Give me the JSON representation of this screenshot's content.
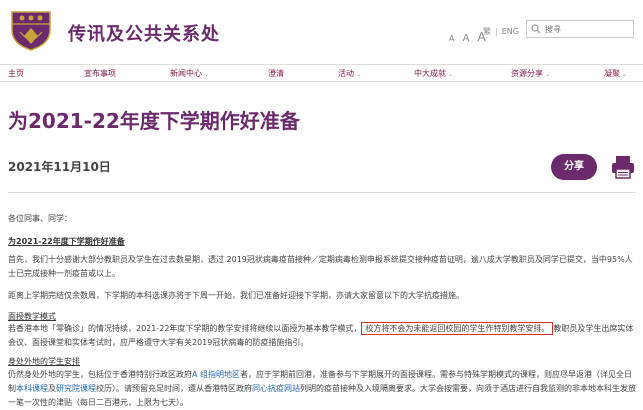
{
  "header": {
    "site_title": "传讯及公共关系处",
    "font_sizes": [
      "A",
      "A",
      "A"
    ],
    "lang_trad": "繁",
    "lang_en": "ENG",
    "search_placeholder": "搜寻"
  },
  "nav": {
    "items": [
      {
        "label": "主页",
        "has_menu": false
      },
      {
        "label": "宣布事项",
        "has_menu": false
      },
      {
        "label": "新闻中心",
        "has_menu": true
      },
      {
        "label": "澄清",
        "has_menu": false
      },
      {
        "label": "活动",
        "has_menu": true
      },
      {
        "label": "中大成就",
        "has_menu": true
      },
      {
        "label": "资源分享",
        "has_menu": true
      },
      {
        "label": "凝聚",
        "has_menu": true
      }
    ],
    "chevron": "⌄"
  },
  "article": {
    "title": "为2021-22年度下学期作好准备",
    "date": "2021年11月10日",
    "share_label": "分享",
    "greeting": "各位同事、同学：",
    "heading1": "为2021-22年度下学期作好准备",
    "para1": "首先，我们十分感谢大部分教职员及学生在过去数星期，透过 2019冠状病毒疫苗接种／定期病毒检测申报系统提交接种疫苗证明，逾八成大学教职员及同学已提交，当中95%人士已完成接种一剂疫苗或以上。",
    "para2": "距离上学期完结仅余数周，下学期的本科选课亦将于下周一开始，我们已准备好迎接下学期，亦请大家留意以下的大学抗疫措施。",
    "heading2": "面授教学模式",
    "para3_a": "若香港本地「零确诊」的情况持续，2021-22年度下学期的教学安排将继续以面授为基本教学模式，",
    "para3_highlight": "校方将不会为未能返回校园的学生作特别教学安排。",
    "para3_b": "教职员及学生出席实体会议、面授课堂和实体考试时，应严格遵守大学有关2019冠状病毒的防疫措施指引。",
    "heading3": "身处外地的学生安排",
    "para4_a": "仍然身处外地的学生，包括位于香港特别行政区政府",
    "para4_link1": "A 组指明地区",
    "para4_b": "者，应于学期前回港，准备参与下学期展开的面授课程。需参与特殊学期模式的课程，则应尽早返港（详见全日制",
    "para4_link2": "本科课程",
    "para4_c": "及",
    "para4_link3": "研究院课程",
    "para4_d": "校历）。请预留充足时间，遵从香港特区政府",
    "para4_link4": "同心抗疫网站",
    "para4_e": "列明的疫苗接种及入境隔离要求。大学会按需要，向须于酒店进行自我监测的非本地本科生发放一笔一次性的津贴（每日二百港元，上限为七天）。"
  },
  "colors": {
    "brand_purple": "#6b2a6b",
    "nav_text": "#8a1a4a",
    "highlight_border": "#d9301e",
    "link": "#2a6ab0"
  },
  "icons": [
    "cuhk-logo",
    "search-icon",
    "printer-icon",
    "chevron-down-icon"
  ]
}
